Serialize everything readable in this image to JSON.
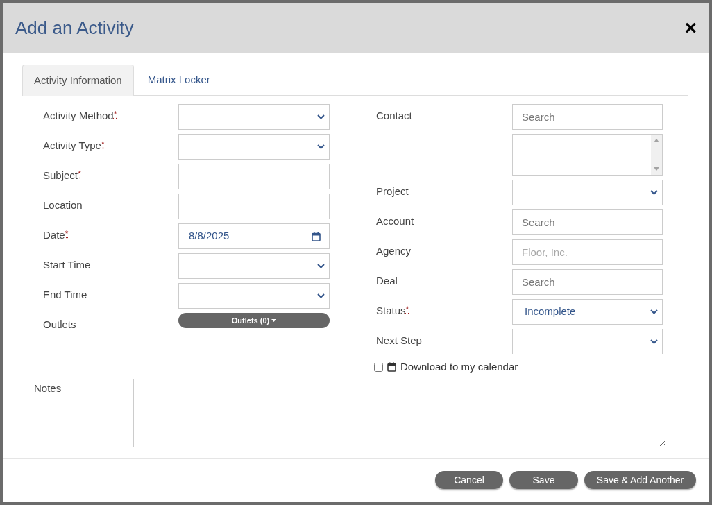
{
  "dialog": {
    "title": "Add an Activity",
    "close": "×"
  },
  "tabs": [
    {
      "label": "Activity Information",
      "selected": true
    },
    {
      "label": "Matrix Locker",
      "selected": false
    }
  ],
  "left_fields": [
    {
      "label": "Activity Method",
      "mark": "*",
      "kind": "select"
    },
    {
      "label": "Activity Type",
      "mark": "*",
      "kind": "select"
    },
    {
      "label": "Subject",
      "mark": "*",
      "kind": "text"
    },
    {
      "label": "Location",
      "kind": "text"
    },
    {
      "label": "Date",
      "mark": "*",
      "kind": "date",
      "value": "8/8/2025"
    },
    {
      "label": "Start Time",
      "kind": "select"
    },
    {
      "label": "End Time",
      "kind": "select"
    },
    {
      "label": "Outlets",
      "kind": "dropdown_button",
      "button": "Outlets (0)"
    }
  ],
  "right_fields": [
    {
      "label": "Contact",
      "kind": "search",
      "placeholder": "Search"
    },
    {
      "kind": "listbox"
    },
    {
      "label": "Project",
      "kind": "select"
    },
    {
      "label": "Account",
      "kind": "search",
      "placeholder": "Search"
    },
    {
      "label": "Agency",
      "kind": "faded",
      "placeholder": "Floor, Inc."
    },
    {
      "label": "Deal",
      "kind": "search",
      "placeholder": "Search"
    },
    {
      "label": "Status",
      "mark": "*",
      "kind": "select",
      "value": "Incomplete"
    },
    {
      "label": "Next Step",
      "kind": "select"
    }
  ],
  "calendar_option": {
    "label": "Download to my calendar",
    "checked": false
  },
  "notes": {
    "label": "Notes"
  },
  "buttons": [
    "Cancel",
    "Save",
    "Save & Add Another"
  ]
}
